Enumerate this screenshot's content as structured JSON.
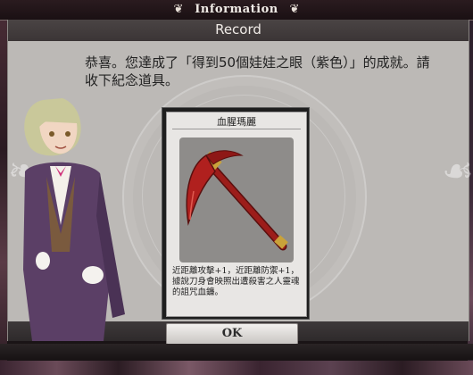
{
  "banner": {
    "title": "Information"
  },
  "window": {
    "header_title": "Record",
    "message": "恭喜。您達成了「得到50個娃娃之眼（紫色）」的成就。請收下紀念道具。"
  },
  "card": {
    "name": "血腥瑪麗",
    "item_icon": "red-scythe-icon",
    "description": "近距離攻擊+1，近距離防禦+1，據說刀身會映照出遭殺害之人靈魂的詛咒血鐮。"
  },
  "ok_button": {
    "label": "OK"
  },
  "colors": {
    "window_bg": "#bcb9b6",
    "header_bg": "#3b3536",
    "scythe_red": "#b0201e",
    "scythe_handle": "#7a1412"
  }
}
